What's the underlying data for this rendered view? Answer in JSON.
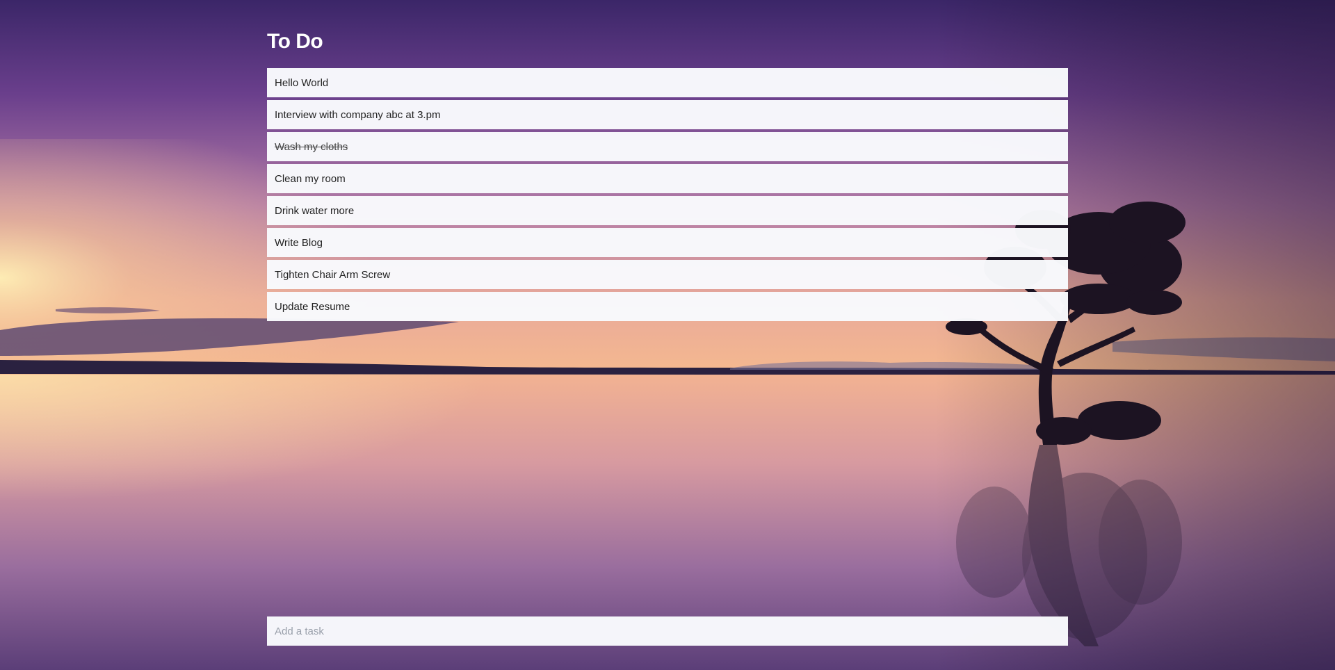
{
  "app": {
    "title": "To Do"
  },
  "tasks": [
    {
      "label": "Hello World",
      "completed": false
    },
    {
      "label": "Interview with company abc at 3.pm",
      "completed": false
    },
    {
      "label": "Wash my cloths",
      "completed": true
    },
    {
      "label": "Clean my room",
      "completed": false
    },
    {
      "label": "Drink water more",
      "completed": false
    },
    {
      "label": "Write Blog",
      "completed": false
    },
    {
      "label": "Tighten Chair Arm Screw",
      "completed": false
    },
    {
      "label": "Update Resume",
      "completed": false
    }
  ],
  "add_task": {
    "value": "",
    "placeholder": "Add a task"
  },
  "background": {
    "sky_top": "#3a2566",
    "sky_mid": "#8a5a99",
    "horizon": "#f3b58f",
    "water": "#6b4a80"
  }
}
